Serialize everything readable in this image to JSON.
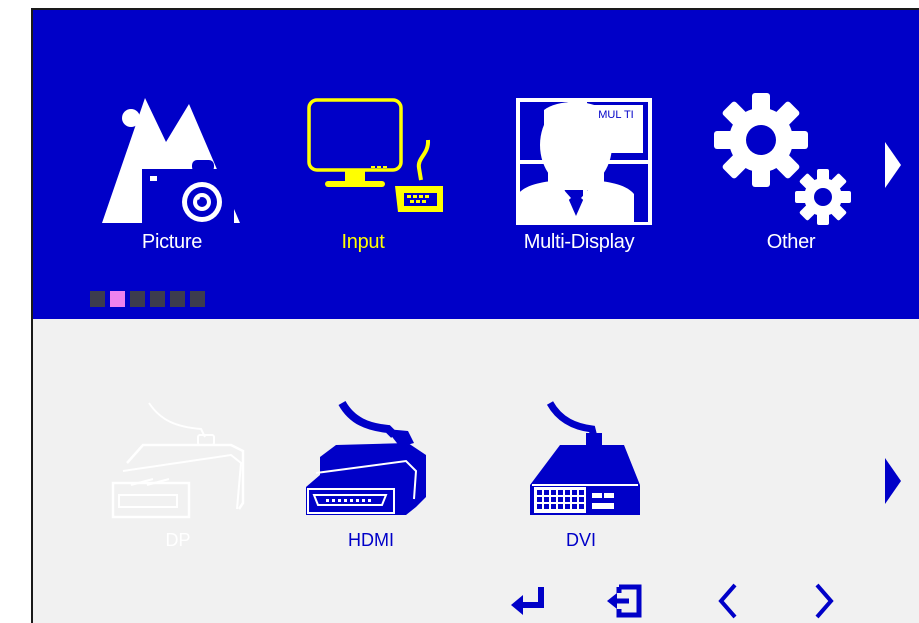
{
  "menu": {
    "items": [
      {
        "label": "Picture",
        "icon": "picture-icon",
        "selected": false
      },
      {
        "label": "Input",
        "icon": "input-icon",
        "selected": true
      },
      {
        "label": "Multi-Display",
        "icon": "multi-display-icon",
        "selected": false
      },
      {
        "label": "Other",
        "icon": "gear-icon",
        "selected": false
      }
    ],
    "multi_badge": "MUL TI",
    "next_arrow_icon": "triangle-right-icon",
    "page_indicator": {
      "count": 6,
      "active_index": 1
    }
  },
  "inputs": {
    "items": [
      {
        "label": "DP",
        "icon": "displayport-connector-icon",
        "enabled": false
      },
      {
        "label": "HDMI",
        "icon": "hdmi-connector-icon",
        "enabled": true
      },
      {
        "label": "DVI",
        "icon": "dvi-connector-icon",
        "enabled": true
      }
    ],
    "next_arrow_icon": "triangle-right-icon"
  },
  "controls": [
    {
      "name": "enter",
      "icon": "enter-icon"
    },
    {
      "name": "exit",
      "icon": "exit-icon"
    },
    {
      "name": "previous",
      "icon": "chevron-left-icon"
    },
    {
      "name": "next",
      "icon": "chevron-right-icon"
    }
  ],
  "colors": {
    "panel_blue": "#0000c8",
    "panel_light": "#f1f1f1",
    "selected_yellow": "#ffff00",
    "active_dot": "#ee82ee",
    "inactive_dot": "#3c3c4e"
  }
}
